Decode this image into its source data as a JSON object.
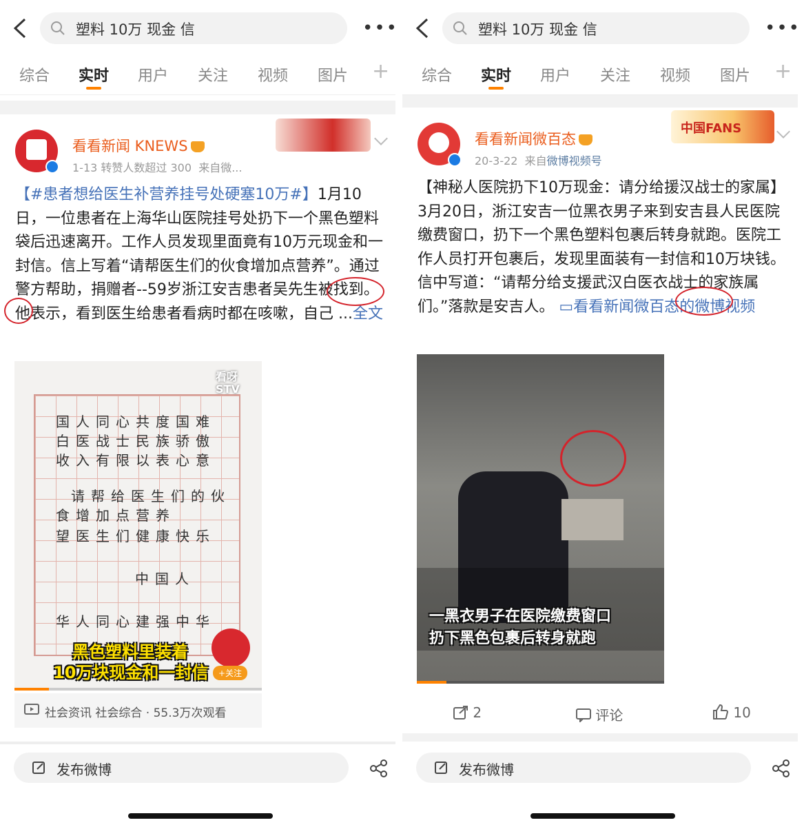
{
  "left": {
    "search": {
      "query": "塑料 10万 现金 信"
    },
    "more": "•••",
    "tabs": [
      "综合",
      "实时",
      "用户",
      "关注",
      "视频",
      "图片"
    ],
    "tab_plus": "+",
    "post": {
      "username": "看看新闻 KNEWS",
      "meta_time": "1-13 转赞人数超过 300",
      "meta_source": "来自微...",
      "hashtag": "【#患者想给医生补营养挂号处硬塞10万#】",
      "text": "1月10日，一位患者在上海华山医院挂号处扔下一个黑色塑料袋后迅速离开。工作人员发现里面竟有10万元现金和一封信。信上写着“请帮医生们的伙食增加点营养”。通过警方帮助，捐赠者--59岁浙江安吉患者吴先生被找到。他表示，看到医生给患者看病时都在咳嗽，自己 ...",
      "more_link": "全文",
      "letter_lines": [
        "国人同心共度国难",
        "白医战士民族骄傲",
        "收入有限以表心意",
        "请帮给医生们的伙",
        "食增加点营养",
        "望医生们健康快乐",
        "中国人",
        "华人同心建强中华"
      ],
      "caption_line1": "黑色塑料里装着",
      "caption_line2": "10万块现金和一封信",
      "watermark": "看呀 STV",
      "follow": "+关注",
      "video_meta": "社会资讯 社会综合 · 55.3万次观看"
    },
    "compose": "发布微博"
  },
  "right": {
    "search": {
      "query": "塑料 10万 现金 信"
    },
    "more": "•••",
    "tabs": [
      "综合",
      "实时",
      "用户",
      "关注",
      "视频",
      "图片"
    ],
    "tab_plus": "+",
    "post": {
      "username": "看看新闻微百态",
      "meta_time": "20-3-22",
      "meta_source_prefix": "来自",
      "meta_source": "微博视频号",
      "badge": "中国FANS",
      "text": "【神秘人医院扔下10万现金：请分给援汉战士的家属】3月20日，浙江安吉一位黑衣男子来到安吉县人民医院缴费窗口，扔下一个黑色塑料包裹后转身就跑。医院工作人员打开包裹后，发现里面装有一封信和10万块钱。信中写道：“请帮分给支援武汉白医衣战士的家族属们。”落款是安吉人。",
      "video_link": "看看新闻微百态的微博视频",
      "caption_line1": "一黑衣男子在医院缴费窗口",
      "caption_line2": "扔下黑色包裹后转身就跑",
      "reposts": "2",
      "comments": "评论",
      "likes": "10"
    },
    "compose": "发布微博"
  },
  "colors": {
    "accent": "#ff8200",
    "link": "#4672b8",
    "username": "#ea5d1d",
    "annotation": "#d4232b"
  }
}
